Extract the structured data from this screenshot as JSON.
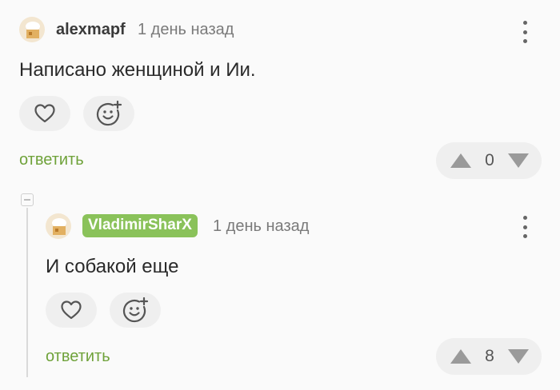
{
  "comment1": {
    "username": "alexmapf",
    "time": "1 день назад",
    "text": "Написано женщиной и Ии.",
    "reply_label": "ответить",
    "rating": "0",
    "icons": {
      "like": "heart-icon",
      "react": "smile-plus-icon",
      "menu": "more-vertical-icon",
      "up": "arrow-up-icon",
      "down": "arrow-down-icon"
    }
  },
  "comment2": {
    "username": "VladimirSharX",
    "time": "1 день назад",
    "text": "И собакой еще",
    "reply_label": "ответить",
    "rating": "8",
    "icons": {
      "like": "heart-icon",
      "react": "smile-plus-icon",
      "menu": "more-vertical-icon",
      "up": "arrow-up-icon",
      "down": "arrow-down-icon"
    }
  },
  "colors": {
    "accent_green": "#6fa23a",
    "badge_green": "#8ac25a",
    "pill_bg": "#efefef",
    "arrow_gray": "#9a9a9a"
  }
}
